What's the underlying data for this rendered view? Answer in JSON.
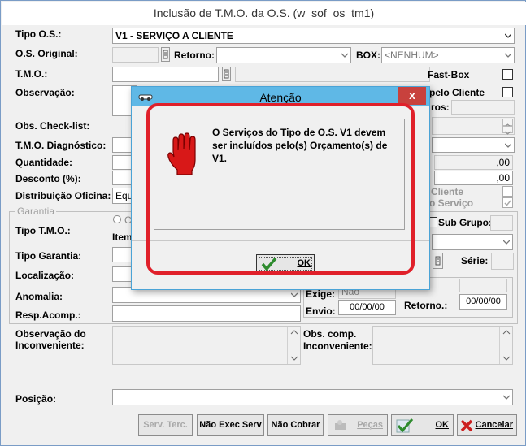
{
  "window": {
    "title": "Inclusão de T.M.O. da O.S. (w_sof_os_tm1)"
  },
  "form": {
    "tipo_os_label": "Tipo O.S.:",
    "tipo_os_value": "V1 - SERVIÇO A CLIENTE",
    "os_original_label": "O.S. Original:",
    "retorno_label": "Retorno:",
    "box_label": "BOX:",
    "box_value": "<NENHUM>",
    "tmo_label": "T.M.O.:",
    "fast_box_label": "Fast-Box",
    "observacao_label": "Observação:",
    "pelo_cliente_label": "pelo Cliente",
    "ros_label": "ros:",
    "obs_checklist_label": "Obs. Check-list:",
    "tmo_diagnostico_label": "T.M.O. Diagnóstico:",
    "quantidade_label": "Quantidade:",
    "quantidade_value": ",00",
    "desconto_label": "Desconto (%):",
    "desconto_value": ",00",
    "distribuicao_label": "Distribuição Oficina:",
    "distribuicao_value": "Equ",
    "cliente_label": "Cliente",
    "servico_label": "o Serviço",
    "garantia_group": "Garantia",
    "tipo_tmo_label": "Tipo T.M.O.:",
    "tipo_tmo_radio": "C",
    "item_label": "Item",
    "sub_grupo_label": "Sub Grupo:",
    "tipo_garantia_label": "Tipo Garantia:",
    "localizacao_label": "Localização:",
    "serie_label": "Série:",
    "anomalia_label": "Anomalia:",
    "exige_label": "Exige:",
    "exige_value": "Não",
    "resp_acomp_label": "Resp.Acomp.:",
    "envio_label": "Envio:",
    "envio_value": "00/00/00",
    "retorno2_label": "Retorno.:",
    "retorno2_value": "00/00/00",
    "obs_inconveniente_label_1": "Observação do",
    "obs_inconveniente_label_2": "Inconveniente:",
    "obs_comp_label_1": "Obs. comp.",
    "obs_comp_label_2": "Inconveniente:",
    "posicao_label": "Posição:"
  },
  "buttons": {
    "serv_terc": "Serv. Terc.",
    "nao_exec_serv": "Não Exec Serv",
    "nao_cobrar": "Não Cobrar",
    "pecas": "Peças",
    "ok": "OK",
    "cancelar": "Cancelar"
  },
  "dialog": {
    "title": "Atenção",
    "message": "O Serviços do Tipo de O.S. V1 devem ser incluídos pelo(s) Orçamento(s) de V1.",
    "ok_label": "OK",
    "close_glyph": "x"
  },
  "colors": {
    "accent": "#5fb8e6",
    "highlight_ring": "#e0202a",
    "ok_check": "#2e8b2e",
    "cancel_x": "#cc1f1f"
  }
}
